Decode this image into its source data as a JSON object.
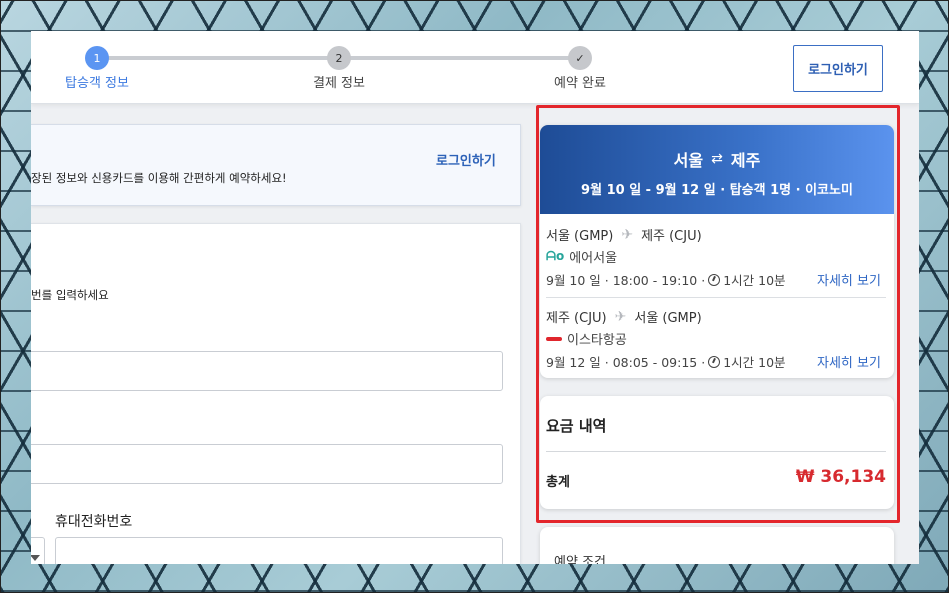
{
  "steps": [
    {
      "num": "1",
      "label": "탑승객 정보",
      "state": "active"
    },
    {
      "num": "2",
      "label": "결제 정보",
      "state": "todo"
    },
    {
      "num": "✓",
      "label": "예약 완료",
      "state": "done"
    }
  ],
  "header": {
    "login_button": "로그인하기"
  },
  "login_prompt": {
    "message": "장된 정보와 신용카드를 이용해 간편하게 예약하세요!",
    "link": "로그인하기"
  },
  "form": {
    "hint": "번를 입력하세요",
    "phone_label": "휴대전화번호"
  },
  "trip": {
    "origin": "서울",
    "swap_icon": "⇄",
    "destination": "제주",
    "summary": "9월 10 일 - 9월 12 일 · 탑승객 1명 · 이코노미",
    "legs": [
      {
        "from": "서울 (GMP)",
        "to": "제주 (CJU)",
        "airline": "에어서울",
        "airline_logo": "airseoul-logo",
        "schedule": "9월 10 일 · 18:00 - 19:10 ·",
        "duration": "1시간 10분",
        "detail_link": "자세히 보기"
      },
      {
        "from": "제주 (CJU)",
        "to": "서울 (GMP)",
        "airline": "이스타항공",
        "airline_logo": "eastar-logo",
        "schedule": "9월 12 일 · 08:05 - 09:15 ·",
        "duration": "1시간 10분",
        "detail_link": "자세히 보기"
      }
    ]
  },
  "fare": {
    "title": "요금 내역",
    "total_label": "총계",
    "total_value": "₩ 36,134"
  },
  "terms": {
    "title": "예약 조건"
  },
  "colors": {
    "accent": "#5b95f2",
    "highlight_border": "#e3262c",
    "price": "#d72a2f",
    "link": "#2e66c4"
  }
}
